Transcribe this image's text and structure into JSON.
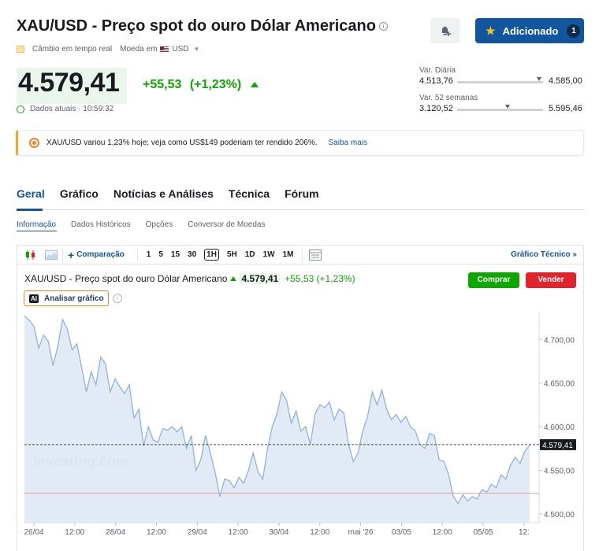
{
  "header": {
    "title": "XAU/USD - Preço spot do ouro Dólar Americano",
    "info_glyph": "i",
    "subline_rate": "Câmbio em tempo real",
    "subline_currency_label": "Moeda em",
    "subline_currency": "USD",
    "added_label": "Adicionado",
    "added_count": "1"
  },
  "quote": {
    "price": "4.579,41",
    "change": "+55,53",
    "change_pct": "(+1,23%)",
    "time_label": "Dados atuais · 10:59:32"
  },
  "ranges": {
    "daily_label": "Var. Diária",
    "daily_low": "4.513,76",
    "daily_high": "4.585,00",
    "daily_position": 0.95,
    "weeks_label": "Var. 52 semanas",
    "weeks_low": "3.120,52",
    "weeks_high": "5.595,46",
    "weeks_position": 0.59
  },
  "banner": {
    "text": "XAU/USD variou 1,23% hoje; veja como US$149 poderiam ter rendido 206%.",
    "link": "Saiba mais"
  },
  "tabs": [
    "Geral",
    "Gráfico",
    "Notícias e Análises",
    "Técnica",
    "Fórum"
  ],
  "subtabs": [
    "Informação",
    "Dados Históricos",
    "Opções",
    "Conversor de Moedas"
  ],
  "toolbar": {
    "compare": "Comparação",
    "intervals": [
      "1",
      "5",
      "15",
      "30",
      "1H",
      "5H",
      "1D",
      "1W",
      "1M"
    ],
    "selected_interval": "1H",
    "technical": "Gráfico Técnico »"
  },
  "chart_header": {
    "title": "XAU/USD - Preço spot do ouro Dólar Americano",
    "price": "4.579,41",
    "change": "+55,53 (+1,23%)",
    "buy": "Comprar",
    "sell": "Vender",
    "ai_badge": "AI",
    "ai_label": "Analisar gráfico",
    "info_glyph": "i"
  },
  "chart_data": {
    "type": "area",
    "watermark": "Investing.com",
    "ylim": [
      4490,
      4730
    ],
    "yticks": [
      4500,
      4550,
      4600,
      4650,
      4700
    ],
    "ytick_labels": [
      "4.500,00",
      "4.550,00",
      "4.600,00",
      "4.650,00",
      "4.700,00"
    ],
    "current_value": 4579.41,
    "current_label": "4.579,41",
    "reference_value": 4523.88,
    "xtick_labels": [
      "26/04",
      "12:00",
      "28/04",
      "12:00",
      "29/04",
      "12:00",
      "30/04",
      "12:00",
      "mai '26",
      "03/05",
      "12:00",
      "05/05",
      "12:"
    ],
    "values": [
      4727,
      4722,
      4715,
      4690,
      4705,
      4698,
      4670,
      4692,
      4723,
      4712,
      4688,
      4695,
      4668,
      4640,
      4663,
      4648,
      4680,
      4672,
      4640,
      4655,
      4646,
      4638,
      4648,
      4610,
      4620,
      4578,
      4600,
      4585,
      4582,
      4598,
      4596,
      4600,
      4594,
      4600,
      4575,
      4590,
      4550,
      4562,
      4590,
      4570,
      4548,
      4520,
      4540,
      4538,
      4530,
      4542,
      4535,
      4550,
      4570,
      4548,
      4540,
      4575,
      4600,
      4615,
      4640,
      4630,
      4604,
      4618,
      4595,
      4600,
      4580,
      4615,
      4625,
      4622,
      4628,
      4608,
      4620,
      4616,
      4580,
      4560,
      4570,
      4595,
      4612,
      4640,
      4625,
      4642,
      4620,
      4608,
      4614,
      4605,
      4612,
      4600,
      4595,
      4580,
      4575,
      4592,
      4590,
      4562,
      4560,
      4545,
      4520,
      4512,
      4522,
      4515,
      4520,
      4517,
      4528,
      4525,
      4534,
      4530,
      4545,
      4540,
      4556,
      4565,
      4558,
      4572,
      4579
    ]
  }
}
